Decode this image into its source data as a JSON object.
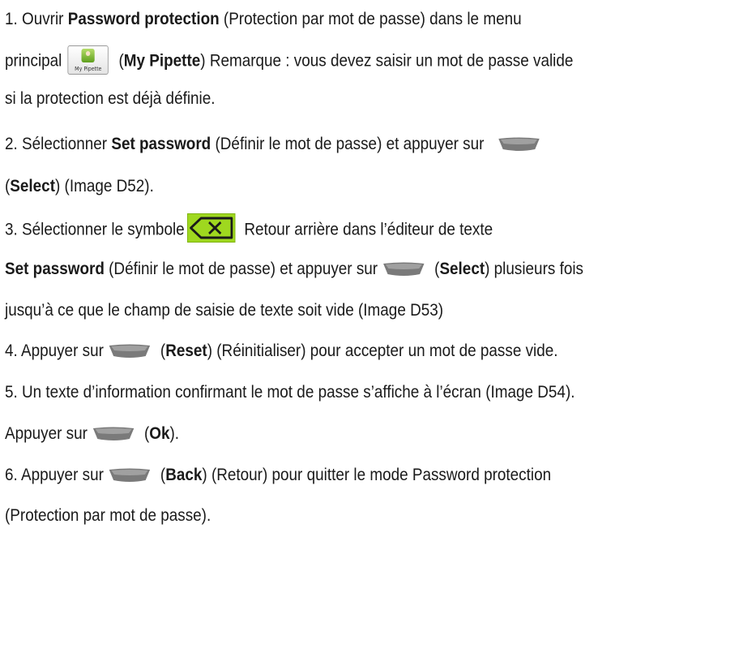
{
  "steps": {
    "s1": {
      "a": "1.  Ouvrir ",
      "b1": "Password protection",
      "c": " (Protection par mot de passe) dans le menu",
      "d": "principal",
      "icon_caption": "My Pipette",
      "e": " (",
      "b2": "My Pipette",
      "f": ") Remarque : vous devez saisir un mot de passe valide",
      "g": "si la protection est déjà définie."
    },
    "s2": {
      "a": "2.  Sélectionner ",
      "b1": "Set password",
      "c": " (Définir le mot de passe) et appuyer sur",
      "d": "(",
      "b2": "Select",
      "e": ") (Image D52)."
    },
    "s3": {
      "a": "3.  Sélectionner le symbole",
      "b": " Retour arrière dans l’éditeur de texte",
      "b1": "Set password",
      "c": " (Définir le mot de passe) et appuyer sur",
      "d": " (",
      "b2": "Select",
      "e": ") plusieurs fois",
      "f": "jusqu’à ce que le champ de saisie de texte soit vide (Image D53)"
    },
    "s4": {
      "a": "4.  Appuyer sur",
      "b": " (",
      "b1": "Reset",
      "c": ") (Réinitialiser) pour accepter un mot de passe vide."
    },
    "s5": {
      "a": "5.  Un texte d’information confirmant le mot de passe s’affiche à l’écran (Image D54).",
      "b": "Appuyer sur",
      "c": " (",
      "b1": "Ok",
      "d": ")."
    },
    "s6": {
      "a": "6.  Appuyer sur",
      "b": " (",
      "b1": "Back",
      "c": ") (Retour) pour quitter le mode Password protection",
      "d": "(Protection par mot de passe)."
    }
  },
  "icons": {
    "soft_key": "soft-key-icon",
    "backspace": "backspace-icon",
    "my_pipette": "my-pipette-icon"
  },
  "colors": {
    "text": "#1a1a1a",
    "backspace_bg": "#9fd81f",
    "soft_key": "#777777"
  }
}
